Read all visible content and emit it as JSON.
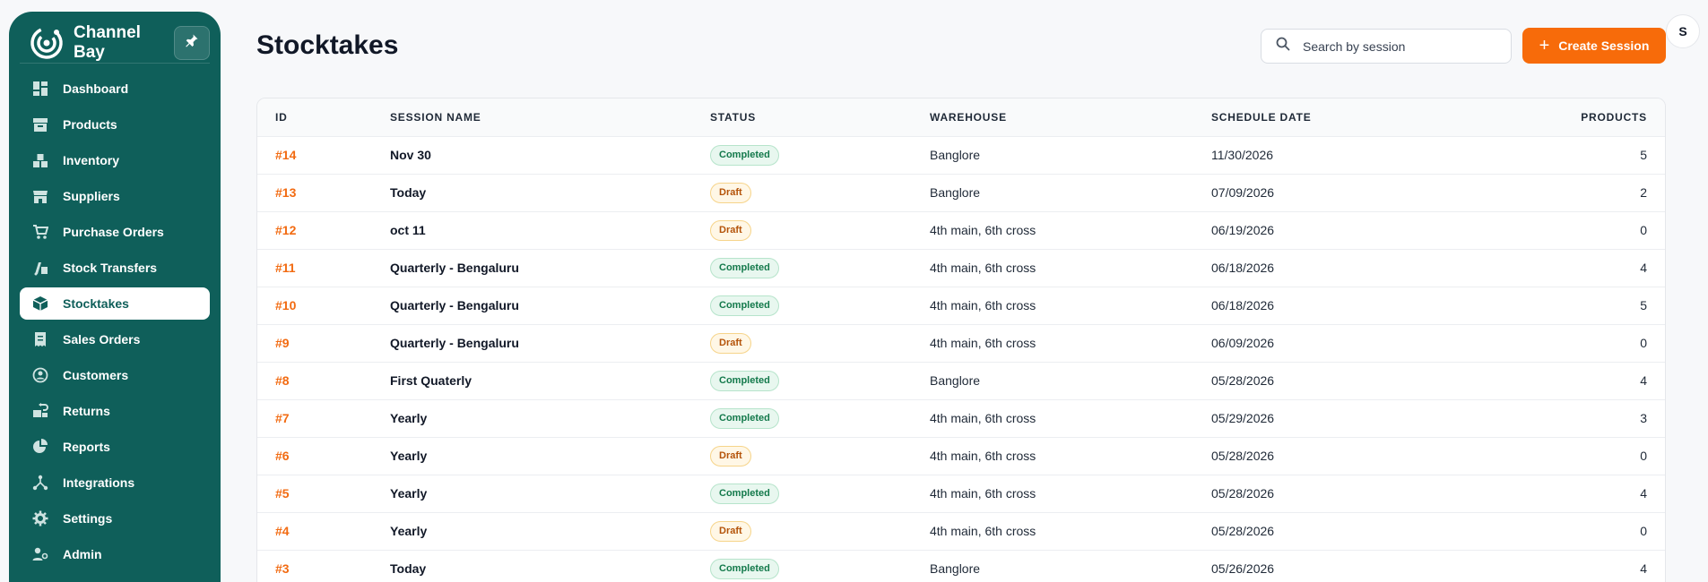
{
  "app": {
    "brand_name": "Channel Bay",
    "accent_color": "#0f5f5a",
    "primary_button_color": "#f76b0a"
  },
  "sidebar": {
    "items": [
      {
        "label": "Dashboard",
        "icon": "dashboard-icon"
      },
      {
        "label": "Products",
        "icon": "products-icon"
      },
      {
        "label": "Inventory",
        "icon": "inventory-icon"
      },
      {
        "label": "Suppliers",
        "icon": "suppliers-icon"
      },
      {
        "label": "Purchase Orders",
        "icon": "cart-icon"
      },
      {
        "label": "Stock Transfers",
        "icon": "transfer-icon"
      },
      {
        "label": "Stocktakes",
        "icon": "box-icon",
        "active": true
      },
      {
        "label": "Sales Orders",
        "icon": "receipt-icon"
      },
      {
        "label": "Customers",
        "icon": "customers-icon"
      },
      {
        "label": "Returns",
        "icon": "returns-icon"
      },
      {
        "label": "Reports",
        "icon": "pie-chart-icon"
      },
      {
        "label": "Integrations",
        "icon": "integrations-icon"
      },
      {
        "label": "Settings",
        "icon": "gear-icon"
      },
      {
        "label": "Admin",
        "icon": "admin-icon"
      }
    ]
  },
  "header": {
    "title": "Stocktakes",
    "search_placeholder": "Search by session",
    "create_label": "Create Session",
    "avatar_initial": "S"
  },
  "table": {
    "columns": [
      "ID",
      "SESSION NAME",
      "STATUS",
      "WAREHOUSE",
      "SCHEDULE DATE",
      "PRODUCTS"
    ],
    "rows": [
      {
        "id": "#14",
        "name": "Nov 30",
        "status": "Completed",
        "warehouse": "Banglore",
        "date": "11/30/2026",
        "products": "5"
      },
      {
        "id": "#13",
        "name": "Today",
        "status": "Draft",
        "warehouse": "Banglore",
        "date": "07/09/2026",
        "products": "2"
      },
      {
        "id": "#12",
        "name": "oct 11",
        "status": "Draft",
        "warehouse": "4th main, 6th cross",
        "date": "06/19/2026",
        "products": "0"
      },
      {
        "id": "#11",
        "name": "Quarterly - Bengaluru",
        "status": "Completed",
        "warehouse": "4th main, 6th cross",
        "date": "06/18/2026",
        "products": "4"
      },
      {
        "id": "#10",
        "name": "Quarterly - Bengaluru",
        "status": "Completed",
        "warehouse": "4th main, 6th cross",
        "date": "06/18/2026",
        "products": "5"
      },
      {
        "id": "#9",
        "name": "Quarterly - Bengaluru",
        "status": "Draft",
        "warehouse": "4th main, 6th cross",
        "date": "06/09/2026",
        "products": "0"
      },
      {
        "id": "#8",
        "name": "First Quaterly",
        "status": "Completed",
        "warehouse": "Banglore",
        "date": "05/28/2026",
        "products": "4"
      },
      {
        "id": "#7",
        "name": "Yearly",
        "status": "Completed",
        "warehouse": "4th main, 6th cross",
        "date": "05/29/2026",
        "products": "3"
      },
      {
        "id": "#6",
        "name": "Yearly",
        "status": "Draft",
        "warehouse": "4th main, 6th cross",
        "date": "05/28/2026",
        "products": "0"
      },
      {
        "id": "#5",
        "name": "Yearly",
        "status": "Completed",
        "warehouse": "4th main, 6th cross",
        "date": "05/28/2026",
        "products": "4"
      },
      {
        "id": "#4",
        "name": "Yearly",
        "status": "Draft",
        "warehouse": "4th main, 6th cross",
        "date": "05/28/2026",
        "products": "0"
      },
      {
        "id": "#3",
        "name": "Today",
        "status": "Completed",
        "warehouse": "Banglore",
        "date": "05/26/2026",
        "products": "4"
      }
    ]
  }
}
